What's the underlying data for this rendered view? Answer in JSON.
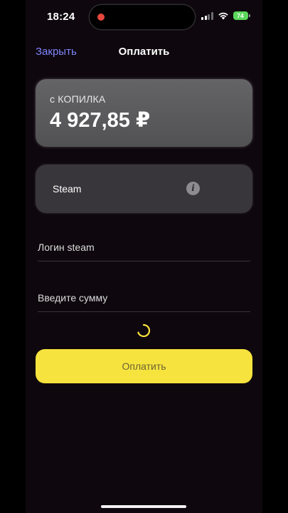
{
  "status_bar": {
    "time": "18:24",
    "battery": "74"
  },
  "nav": {
    "close_label": "Закрыть",
    "title": "Оплатить"
  },
  "balance_card": {
    "label": "с КОПИЛКА",
    "amount": "4 927,85 ₽"
  },
  "service_card": {
    "name": "Steam",
    "info_icon": "info-icon"
  },
  "form": {
    "login_placeholder": "Логин steam",
    "login_value": "",
    "sum_placeholder": "Введите сумму",
    "sum_value": ""
  },
  "pay_button": {
    "label": "Оплатить"
  },
  "colors": {
    "accent_link": "#7d86ff",
    "pay_button": "#f7e33e",
    "battery": "#5bd75b",
    "recording": "#e8473d"
  }
}
